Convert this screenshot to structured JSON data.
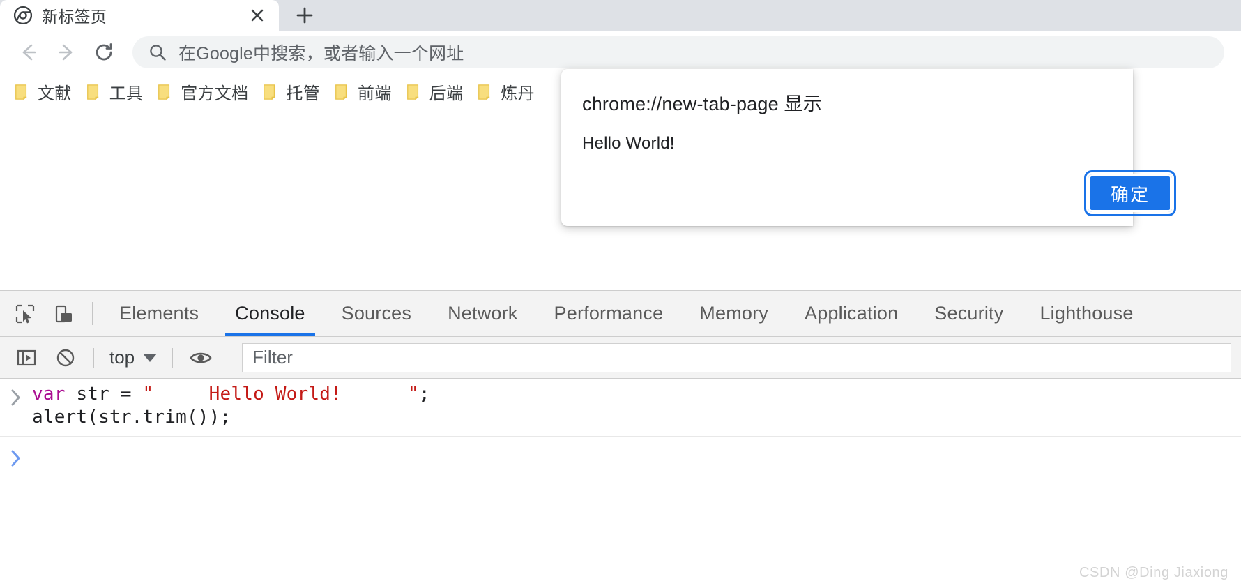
{
  "browser": {
    "tab": {
      "title": "新标签页",
      "favicon_name": "chrome-logo-icon",
      "close_label": "×"
    },
    "new_tab_button_label": "+",
    "toolbar": {
      "back_label": "←",
      "forward_label": "→",
      "reload_label": "⟳",
      "omnibox_placeholder": "在Google中搜索，或者输入一个网址"
    },
    "bookmarks": [
      {
        "label": "文献"
      },
      {
        "label": "工具"
      },
      {
        "label": "官方文档"
      },
      {
        "label": "托管"
      },
      {
        "label": "前端"
      },
      {
        "label": "后端"
      },
      {
        "label": "炼丹"
      }
    ]
  },
  "dialog": {
    "origin": "chrome://new-tab-page 显示",
    "message": "Hello World!",
    "ok_label": "确定",
    "accent_color": "#1a73e8"
  },
  "devtools": {
    "tabs": [
      {
        "label": "Elements",
        "active": false
      },
      {
        "label": "Console",
        "active": true
      },
      {
        "label": "Sources",
        "active": false
      },
      {
        "label": "Network",
        "active": false
      },
      {
        "label": "Performance",
        "active": false
      },
      {
        "label": "Memory",
        "active": false
      },
      {
        "label": "Application",
        "active": false
      },
      {
        "label": "Security",
        "active": false
      },
      {
        "label": "Lighthouse",
        "active": false
      }
    ],
    "active_tab": "Console",
    "console_toolbar": {
      "context_label": "top",
      "filter_placeholder": "Filter"
    },
    "console": {
      "entry_code_line1_prefix": "var ",
      "entry_code_keyword": "var",
      "entry_code_line1": " str = ",
      "entry_code_string": "\"     Hello World!      \"",
      "entry_code_line1_end": ";",
      "entry_code_line2": "alert(str.trim());",
      "prompt_symbol": "›"
    }
  },
  "watermark": "CSDN @Ding Jiaxiong"
}
